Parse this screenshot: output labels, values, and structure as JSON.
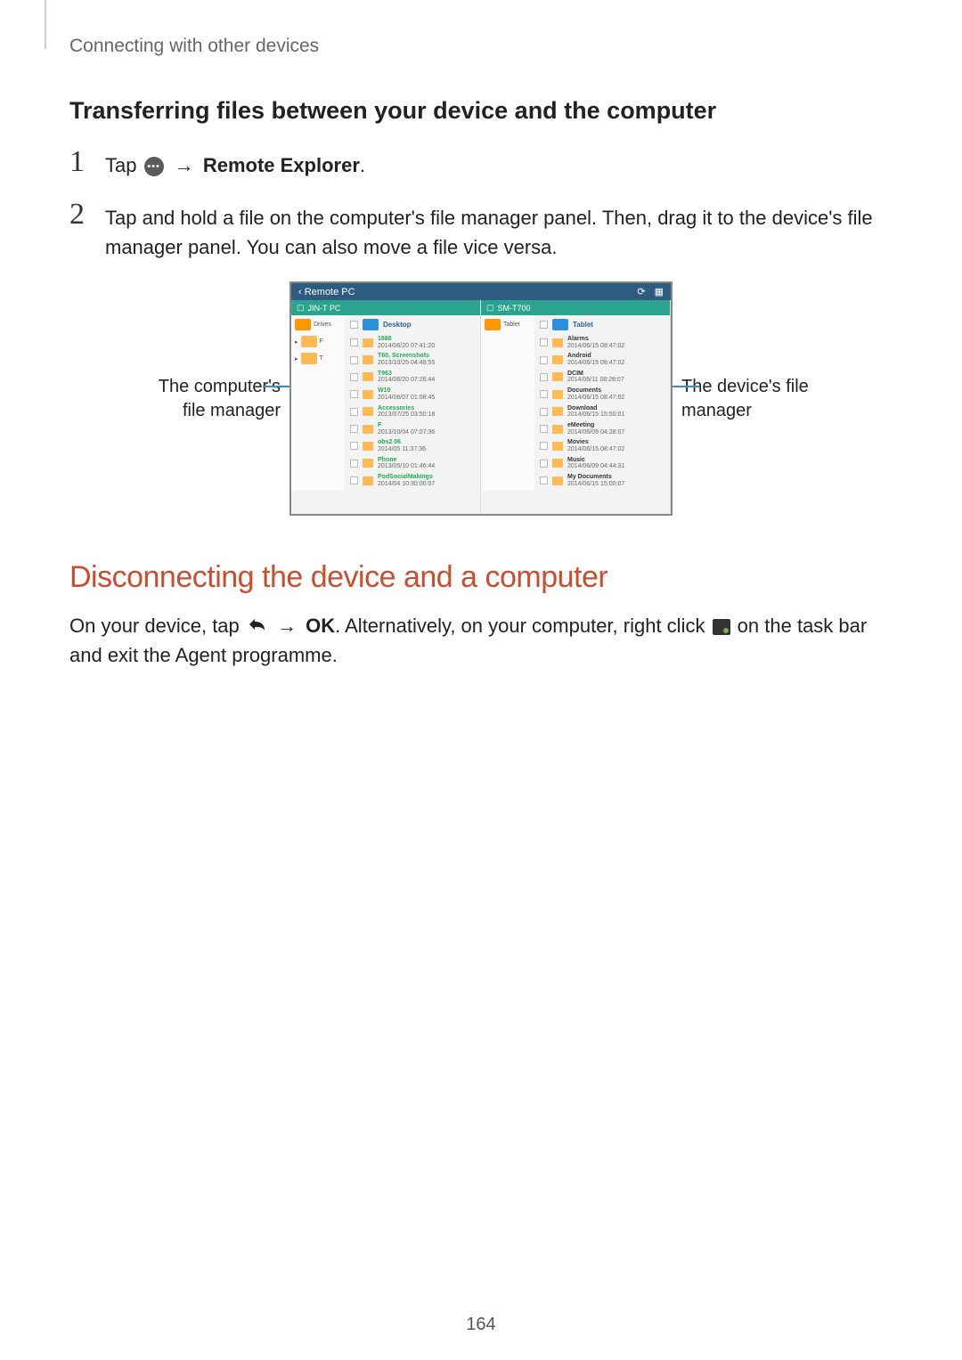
{
  "header": {
    "crumb": "Connecting with other devices"
  },
  "section1": {
    "title": "Transferring files between your device and the computer",
    "step1": {
      "num": "1",
      "pre": "Tap ",
      "post": " → ",
      "bold": "Remote Explorer",
      "end": "."
    },
    "step2": {
      "num": "2",
      "text": "Tap and hold a file on the computer's file manager panel. Then, drag it to the device's file manager panel. You can also move a file vice versa."
    }
  },
  "figure": {
    "left_callout": "The computer's file manager",
    "right_callout": "The device's file manager",
    "titlebar_back": "‹  Remote PC",
    "refresh_icon": "⟳",
    "grid_icon": "▦",
    "left_panel": {
      "path_icon": "▢",
      "path": "JIN-T PC",
      "side": [
        "Drives",
        "F",
        "T"
      ],
      "header": "Desktop",
      "rows": [
        {
          "t1": "1888",
          "t2": "2014/06/20 07:41:20"
        },
        {
          "t1": "T60, Screenshots",
          "t2": "2013/10/25 04:48:55"
        },
        {
          "t1": "T963",
          "t2": "2014/06/20 07:26:44"
        },
        {
          "t1": "W10",
          "t2": "2014/06/07 01:08:45"
        },
        {
          "t1": "Accessories",
          "t2": "2013/07/25 03:50:18"
        },
        {
          "t1": "F",
          "t2": "2013/10/04 07:07:36"
        },
        {
          "t1": "obs2 06",
          "t2": "2014/05 11:37:36"
        },
        {
          "t1": "Phone",
          "t2": "2013/05/10 01:46:44"
        },
        {
          "t1": "PodSocialMakings",
          "t2": "2014/04 10:30:00:07"
        }
      ]
    },
    "right_panel": {
      "path_icon": "▢",
      "path": "SM-T700",
      "side": [
        "Tablet"
      ],
      "header": "Tablet",
      "rows": [
        {
          "t1": "Alarms",
          "t2": "2014/06/15 08:47:02"
        },
        {
          "t1": "Android",
          "t2": "2014/06/15 08:47:02"
        },
        {
          "t1": "DCIM",
          "t2": "2014/06/11 08:28:07"
        },
        {
          "t1": "Documents",
          "t2": "2014/06/15 08:47:02"
        },
        {
          "t1": "Download",
          "t2": "2014/06/15 15:50:01"
        },
        {
          "t1": "eMeeting",
          "t2": "2014/06/09 04:28:07"
        },
        {
          "t1": "Movies",
          "t2": "2014/06/15 08:47:02"
        },
        {
          "t1": "Music",
          "t2": "2014/06/09 04:44:31"
        },
        {
          "t1": "My Documents",
          "t2": "2014/06/15 15:00:07"
        }
      ]
    }
  },
  "section2": {
    "title": "Disconnecting the device and a computer",
    "text_pre": "On your device, tap ",
    "text_mid1": " → ",
    "text_ok": "OK",
    "text_mid2": ". Alternatively, on your computer, right click ",
    "text_end": " on the task bar and exit the Agent programme."
  },
  "pagenum": "164"
}
